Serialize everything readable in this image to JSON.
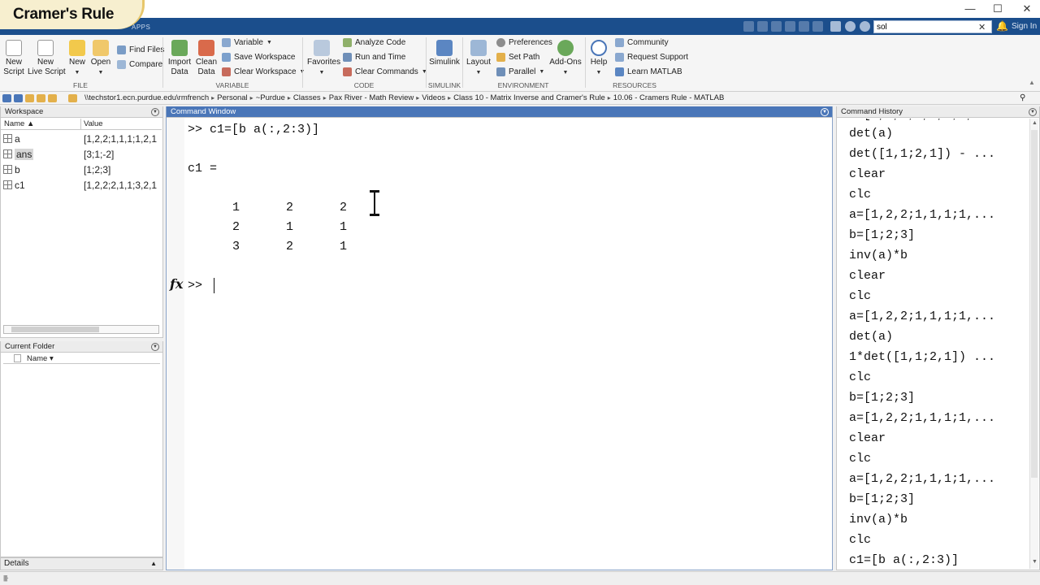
{
  "banner": {
    "title": "Cramer's Rule"
  },
  "window": {
    "minimize": "—",
    "maximize": "☐",
    "close": "✕"
  },
  "tabs": {
    "apps": "APPS"
  },
  "search": {
    "value": "sol",
    "clear": "✕"
  },
  "user": {
    "sign_in": "Sign In"
  },
  "ribbon": {
    "file": {
      "group_label": "FILE",
      "new_script": "New\nScript",
      "new_live_script": "New\nLive Script",
      "new": "New",
      "open": "Open",
      "find_files": "Find Files",
      "compare": "Compare"
    },
    "variable": {
      "group_label": "VARIABLE",
      "import_data": "Import\nData",
      "clean_data": "Clean\nData",
      "variable": "Variable",
      "save_workspace": "Save Workspace",
      "clear_workspace": "Clear Workspace"
    },
    "code": {
      "group_label": "CODE",
      "favorites": "Favorites",
      "analyze_code": "Analyze Code",
      "run_and_time": "Run and Time",
      "clear_commands": "Clear Commands"
    },
    "simulink": {
      "group_label": "SIMULINK",
      "simulink": "Simulink"
    },
    "environment": {
      "group_label": "ENVIRONMENT",
      "layout": "Layout",
      "preferences": "Preferences",
      "set_path": "Set Path",
      "parallel": "Parallel",
      "add_ons": "Add-Ons"
    },
    "resources": {
      "group_label": "RESOURCES",
      "help": "Help",
      "community": "Community",
      "request_support": "Request Support",
      "learn_matlab": "Learn MATLAB"
    }
  },
  "address": {
    "crumbs": [
      "\\\\techstor1.ecn.purdue.edu\\rmfrench",
      "Personal",
      "~Purdue",
      "Classes",
      "Pax River - Math Review",
      "Videos",
      "Class 10 - Matrix Inverse and Cramer's Rule",
      "10.06 - Cramers Rule - MATLAB"
    ]
  },
  "workspace": {
    "title": "Workspace",
    "col_name": "Name ▲",
    "col_value": "Value",
    "rows": [
      {
        "name": "a",
        "value": "[1,2,2;1,1,1;1,2,1"
      },
      {
        "name": "ans",
        "value": "[3;1;-2]"
      },
      {
        "name": "b",
        "value": "[1;2;3]"
      },
      {
        "name": "c1",
        "value": "[1,2,2;2,1,1;3,2,1"
      }
    ]
  },
  "current_folder": {
    "title": "Current Folder",
    "col_name": "Name ▾"
  },
  "details": {
    "title": "Details"
  },
  "command_window": {
    "title": "Command Window",
    "command": ">> c1=[b a(:,2:3)]",
    "output_var": "c1 =",
    "matrix": [
      [
        "1",
        "2",
        "2"
      ],
      [
        "2",
        "1",
        "1"
      ],
      [
        "3",
        "2",
        "1"
      ]
    ],
    "fx": "fx",
    "prompt": ">>"
  },
  "command_history": {
    "title": "Command History",
    "entries": [
      "det(a)",
      "det([1,1;2,1]) - ...",
      "clear",
      "clc",
      "a=[1,2,2;1,1,1;1,...",
      "b=[1;2;3]",
      "inv(a)*b",
      "clear",
      "clc",
      "a=[1,2,2;1,1,1;1,...",
      "det(a)",
      "1*det([1,1;2,1]) ...",
      "clc",
      "b=[1;2;3]",
      "a=[1,2,2;1,1,1;1,...",
      "clear",
      "clc",
      "a=[1,2,2;1,1,1;1,...",
      "b=[1;2;3]",
      "inv(a)*b",
      "clc",
      "c1=[b a(:,2:3)]"
    ]
  },
  "colors": {
    "accent": "#1b4e8c",
    "cw_header": "#4a76b8",
    "banner": "#f7efcf"
  }
}
